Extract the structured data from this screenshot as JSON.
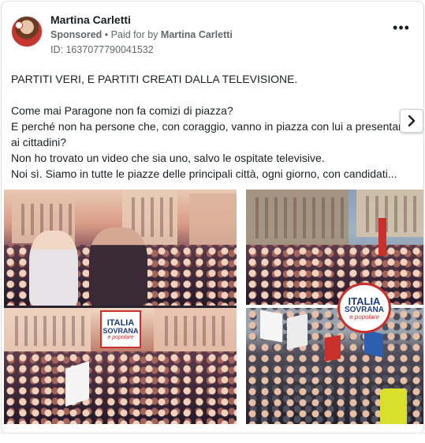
{
  "ad": {
    "page_name": "Martina Carletti",
    "sponsored_label": "Sponsored",
    "separator": "•",
    "paid_for_prefix": "Paid for by",
    "paid_for_name": "Martina Carletti",
    "id_label": "ID: 1637077790041532",
    "more_label": "•••"
  },
  "post": {
    "headline": "PARTITI VERI, E PARTITI CREATI DALLA TELEVISIONE.",
    "line1": "Come mai Paragone non fa comizi di piazza?",
    "line2": "E perché non ha persone che, con coraggio, vanno in piazza con lui a presentarsi ai cittadini?",
    "line3": "Non ho trovato un video che sia uno, salvo le ospitate televisive.",
    "line4": "Noi sì. Siamo in tutte le piazze delle principali città, ogni giorno, con candidati..."
  },
  "logos": {
    "line1": "ITALIA",
    "line2": "SOVRANA",
    "line3": "e popolare"
  },
  "icons": {
    "more": "more-horizontal-icon",
    "next": "chevron-right-icon"
  },
  "colors": {
    "text_primary": "#1c1e21",
    "text_secondary": "#65676b",
    "logo_blue": "#1f3a7a",
    "logo_red": "#c9302c",
    "border": "#dddfe2"
  }
}
